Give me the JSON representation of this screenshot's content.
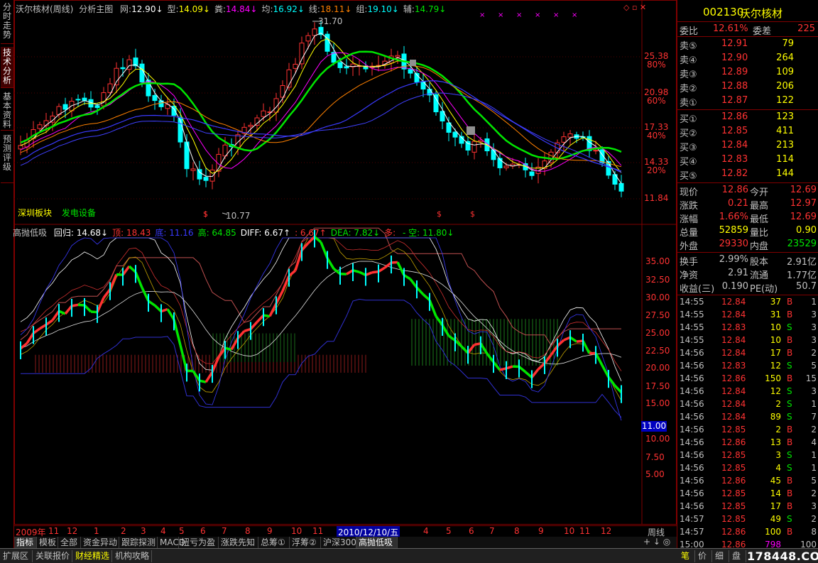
{
  "colors": {
    "red": "#ff3232",
    "green": "#00e600",
    "cyan": "#00ffff",
    "yellow": "#ffff00",
    "white": "#ffffff",
    "grid": "#800000",
    "blue": "#3a3aff",
    "magenta": "#ff00ff"
  },
  "left_tabs": [
    "分时走势",
    "技术分析",
    "基本资料",
    "预测评级"
  ],
  "main_header": {
    "title": "沃尔核材(周线)",
    "template": "分析主图",
    "items": [
      {
        "label": "网:",
        "value": "12.90↓"
      },
      {
        "label": "型:",
        "value": "14.09↓"
      },
      {
        "label": "粪:",
        "value": "14.84↓"
      },
      {
        "label": "均:",
        "value": "16.92↓"
      },
      {
        "label": "线:",
        "value": "18.11↓"
      },
      {
        "label": "组:",
        "value": "19.10↓"
      },
      {
        "label": "辅:",
        "value": "14.79↓"
      }
    ]
  },
  "main_annotations": {
    "high": "31.70",
    "low": "10.77",
    "sector": "深圳板块",
    "industry": "发电设备",
    "marker": "$"
  },
  "main_axis": [
    {
      "v": "25.38",
      "p": "80%"
    },
    {
      "v": "20.98",
      "p": "60%"
    },
    {
      "v": "17.33",
      "p": "40%"
    },
    {
      "v": "14.33",
      "p": "20%"
    },
    {
      "v": "11.84",
      "p": ""
    }
  ],
  "sub_header": {
    "name": "高抛低吸",
    "items": [
      {
        "t": "回归: 14.68↓",
        "c": "#ffffff"
      },
      {
        "t": "顶: 18.43",
        "c": "#ff3232"
      },
      {
        "t": "底: 11.16",
        "c": "#3a3aff"
      },
      {
        "t": "高: 64.85",
        "c": "#00e600"
      },
      {
        "t": "DIFF: 6.67↑",
        "c": "#ffffff"
      },
      {
        "t": ": 6.67↑",
        "c": "#ff3232"
      },
      {
        "t": "DEA: 7.82↓",
        "c": "#00e600"
      },
      {
        "t": "多: ",
        "c": "#ff3232"
      },
      {
        "t": "- 空: 11.80↓",
        "c": "#00e600"
      }
    ]
  },
  "sub_axis": [
    "35.00",
    "32.50",
    "30.00",
    "27.50",
    "25.00",
    "22.50",
    "20.00",
    "17.50",
    "15.00",
    "11.00",
    "10.00",
    "7.50",
    "5.00"
  ],
  "sub_current": "11.00",
  "date_axis": {
    "labels": [
      "2009年",
      "11",
      "12",
      "1",
      "2",
      "3",
      "4",
      "5",
      "6",
      "7",
      "8",
      "9",
      "10",
      "11",
      "2010/12/10/五",
      "4",
      "5",
      "6",
      "7",
      "8",
      "9",
      "10",
      "11",
      "12"
    ],
    "period": "周线"
  },
  "bottom_tabs": [
    "指标",
    "模板",
    "全部",
    "资金异动",
    "跟踪探测",
    "MACD",
    "扭亏为盈",
    "涨跌先知",
    "总筹①",
    "浮筹②",
    "沪深300",
    "高抛低吸"
  ],
  "bottom_bar": [
    {
      "t": "扩展区",
      "y": false
    },
    {
      "t": "关联报价",
      "y": false
    },
    {
      "t": "财经精选",
      "y": true
    },
    {
      "t": "机构攻略",
      "y": false
    }
  ],
  "right_panel": {
    "code": "002130",
    "name": "沃尔核材",
    "weibi": {
      "label": "委比",
      "value": "12.61%",
      "label2": "委差",
      "value2": "225"
    },
    "asks": [
      {
        "l": "卖⑤",
        "p": "12.91",
        "v": "79"
      },
      {
        "l": "卖④",
        "p": "12.90",
        "v": "264"
      },
      {
        "l": "卖③",
        "p": "12.89",
        "v": "109"
      },
      {
        "l": "卖②",
        "p": "12.88",
        "v": "206"
      },
      {
        "l": "卖①",
        "p": "12.87",
        "v": "122"
      }
    ],
    "bids": [
      {
        "l": "买①",
        "p": "12.86",
        "v": "123"
      },
      {
        "l": "买②",
        "p": "12.85",
        "v": "411"
      },
      {
        "l": "买③",
        "p": "12.84",
        "v": "213"
      },
      {
        "l": "买④",
        "p": "12.83",
        "v": "114"
      },
      {
        "l": "买⑤",
        "p": "12.82",
        "v": "144"
      }
    ],
    "quote": [
      {
        "l1": "现价",
        "v1": "12.86",
        "c1": "#ff3232",
        "l2": "今开",
        "v2": "12.69",
        "c2": "#ff3232"
      },
      {
        "l1": "涨跌",
        "v1": "0.21",
        "c1": "#ff3232",
        "l2": "最高",
        "v2": "12.97",
        "c2": "#ff3232"
      },
      {
        "l1": "涨幅",
        "v1": "1.66%",
        "c1": "#ff3232",
        "l2": "最低",
        "v2": "12.69",
        "c2": "#ff3232"
      },
      {
        "l1": "总量",
        "v1": "52859",
        "c1": "#ffff00",
        "l2": "量比",
        "v2": "0.90",
        "c2": "#ffff00"
      },
      {
        "l1": "外盘",
        "v1": "29330",
        "c1": "#ff3232",
        "l2": "内盘",
        "v2": "23529",
        "c2": "#00e600"
      }
    ],
    "fund": [
      {
        "l1": "换手",
        "v1": "2.99%",
        "l2": "股本",
        "v2": "2.91亿"
      },
      {
        "l1": "净资",
        "v1": "2.91",
        "l2": "流通",
        "v2": "1.77亿"
      },
      {
        "l1": "收益(三)",
        "v1": "0.190",
        "l2": "PE(动)",
        "v2": "50.7"
      }
    ],
    "ticks": [
      {
        "t": "14:55",
        "p": "12.84",
        "v": "37",
        "s": "B",
        "n": "1"
      },
      {
        "t": "14:55",
        "p": "12.84",
        "v": "31",
        "s": "B",
        "n": "3"
      },
      {
        "t": "14:55",
        "p": "12.83",
        "v": "10",
        "s": "S",
        "n": "3"
      },
      {
        "t": "14:55",
        "p": "12.84",
        "v": "10",
        "s": "B",
        "n": "3"
      },
      {
        "t": "14:56",
        "p": "12.84",
        "v": "17",
        "s": "B",
        "n": "2"
      },
      {
        "t": "14:56",
        "p": "12.83",
        "v": "12",
        "s": "S",
        "n": "5"
      },
      {
        "t": "14:56",
        "p": "12.86",
        "v": "150",
        "s": "B",
        "n": "15"
      },
      {
        "t": "14:56",
        "p": "12.84",
        "v": "12",
        "s": "S",
        "n": "3"
      },
      {
        "t": "14:56",
        "p": "12.84",
        "v": "2",
        "s": "S",
        "n": "1"
      },
      {
        "t": "14:56",
        "p": "12.84",
        "v": "89",
        "s": "S",
        "n": "7"
      },
      {
        "t": "14:56",
        "p": "12.85",
        "v": "2",
        "s": "B",
        "n": "2"
      },
      {
        "t": "14:56",
        "p": "12.86",
        "v": "13",
        "s": "B",
        "n": "4"
      },
      {
        "t": "14:56",
        "p": "12.85",
        "v": "3",
        "s": "S",
        "n": "1"
      },
      {
        "t": "14:56",
        "p": "12.85",
        "v": "4",
        "s": "S",
        "n": "1"
      },
      {
        "t": "14:56",
        "p": "12.86",
        "v": "45",
        "s": "B",
        "n": "5"
      },
      {
        "t": "14:56",
        "p": "12.85",
        "v": "14",
        "s": "B",
        "n": "2"
      },
      {
        "t": "14:56",
        "p": "12.85",
        "v": "17",
        "s": "B",
        "n": "3"
      },
      {
        "t": "14:57",
        "p": "12.85",
        "v": "49",
        "s": "S",
        "n": "2"
      },
      {
        "t": "14:57",
        "p": "12.86",
        "v": "100",
        "s": "B",
        "n": "8"
      },
      {
        "t": "15:00",
        "p": "12.86",
        "v": "798",
        "s": "",
        "n": "100"
      }
    ],
    "bottom_tabs": [
      "笔",
      "价",
      "细",
      "盘"
    ]
  },
  "watermark": "178448.COM"
}
